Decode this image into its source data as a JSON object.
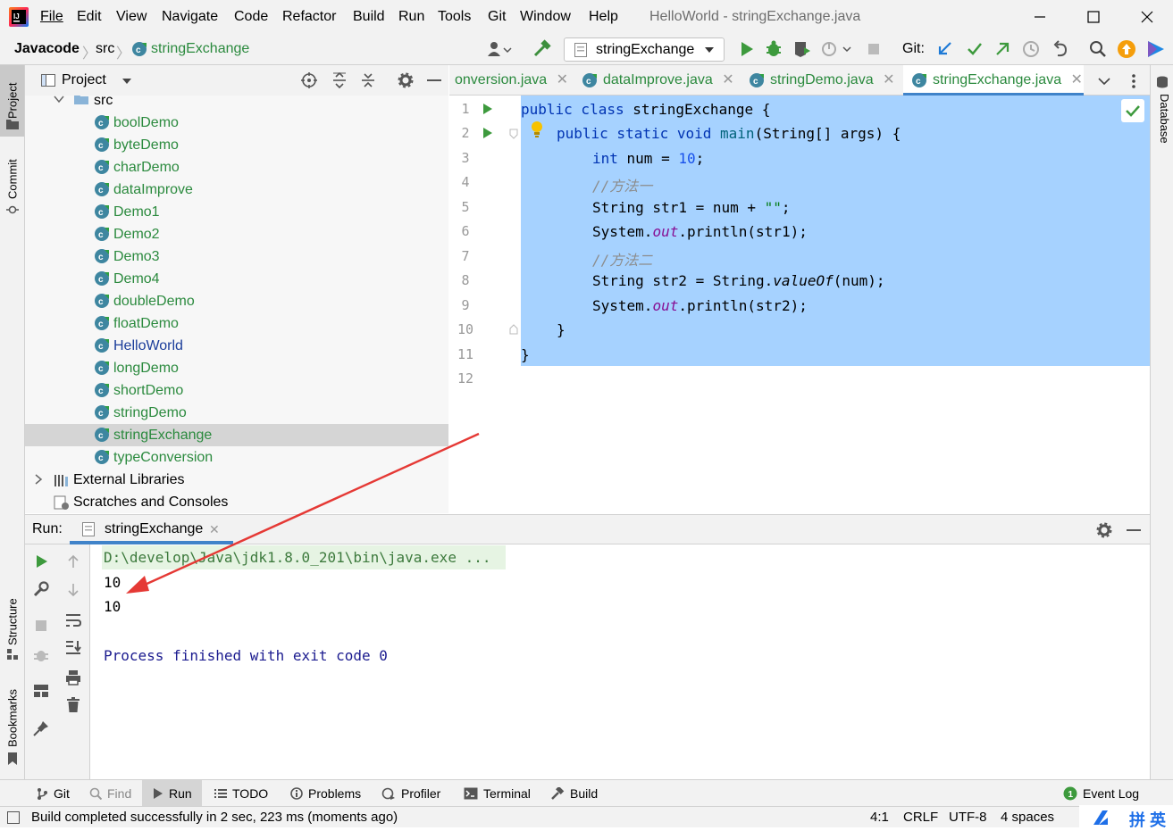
{
  "menu": [
    "File",
    "Edit",
    "View",
    "Navigate",
    "Code",
    "Refactor",
    "Build",
    "Run",
    "Tools",
    "Git",
    "Window",
    "Help"
  ],
  "window_title": "HelloWorld - stringExchange.java",
  "breadcrumb": {
    "project": "Javacode",
    "folder": "src",
    "file": "stringExchange"
  },
  "run_config": "stringExchange",
  "git_label": "Git:",
  "project_panel": {
    "title": "Project",
    "src_label": "src",
    "items": [
      "boolDemo",
      "byteDemo",
      "charDemo",
      "dataImprove",
      "Demo1",
      "Demo2",
      "Demo3",
      "Demo4",
      "doubleDemo",
      "floatDemo",
      "HelloWorld",
      "longDemo",
      "shortDemo",
      "stringDemo",
      "stringExchange",
      "typeConversion"
    ],
    "selected": "stringExchange",
    "external_libraries": "External Libraries",
    "scratches": "Scratches and Consoles"
  },
  "editor_tabs": [
    "onversion.java",
    "dataImprove.java",
    "stringDemo.java",
    "stringExchange.java"
  ],
  "editor": {
    "line_numbers": [
      "1",
      "2",
      "3",
      "4",
      "5",
      "6",
      "7",
      "8",
      "9",
      "10",
      "11",
      "12"
    ],
    "code": {
      "l1a": "public class ",
      "l1b": "stringExchange {",
      "l2a": "public static void ",
      "l2b": "main",
      "l2c": "(String[] args) {",
      "l3a": "int ",
      "l3b": "num = ",
      "l3c": "10",
      "l3d": ";",
      "l4": "//方法一",
      "l5a": "String str1 = num + ",
      "l5b": "\"\"",
      "l5c": ";",
      "l6a": "System.",
      "l6b": "out",
      "l6c": ".println(str1);",
      "l7": "//方法二",
      "l8a": "String str2 = String.",
      "l8b": "valueOf",
      "l8c": "(num);",
      "l9a": "System.",
      "l9b": "out",
      "l9c": ".println(str2);",
      "l10": "}",
      "l11": "}"
    }
  },
  "side_tabs": {
    "project": "Project",
    "commit": "Commit",
    "structure": "Structure",
    "bookmarks": "Bookmarks",
    "database": "Database"
  },
  "run_panel": {
    "label": "Run:",
    "tab": "stringExchange",
    "console": [
      "D:\\develop\\Java\\jdk1.8.0_201\\bin\\java.exe ...",
      "10",
      "10",
      "",
      "Process finished with exit code 0"
    ]
  },
  "bottom_tabs": [
    "Git",
    "Find",
    "Run",
    "TODO",
    "Problems",
    "Profiler",
    "Terminal",
    "Build"
  ],
  "event_log": "Event Log",
  "status": {
    "message": "Build completed successfully in 2 sec, 223 ms (moments ago)",
    "position": "4:1",
    "line_sep": "CRLF",
    "encoding": "UTF-8",
    "indent": "4 spaces",
    "ime": "拼 英"
  },
  "colors": {
    "selection": "#a6d2ff",
    "class_green": "#2b8a3e",
    "keyword": "#0033b3",
    "arrow": "#e53935"
  }
}
